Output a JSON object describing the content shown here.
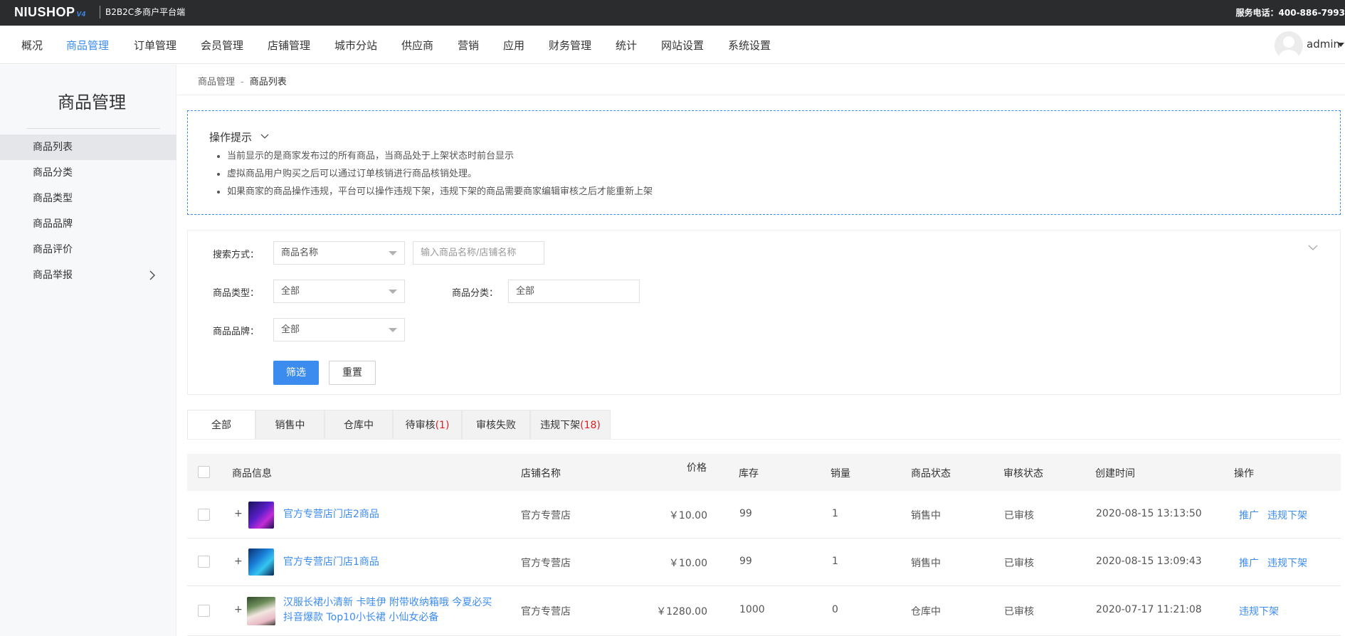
{
  "topbar": {
    "logo": "NIUSHOP",
    "logo_version": "V4",
    "subtitle": "B2B2C多商户平台端",
    "hotline": "服务电话：400-886-7993"
  },
  "nav": {
    "items": [
      "概况",
      "商品管理",
      "订单管理",
      "会员管理",
      "店铺管理",
      "城市分站",
      "供应商",
      "营销",
      "应用",
      "财务管理",
      "统计",
      "网站设置",
      "系统设置"
    ],
    "active": "商品管理",
    "user": "admin"
  },
  "sidebar": {
    "title": "商品管理",
    "items": [
      "商品列表",
      "商品分类",
      "商品类型",
      "商品品牌",
      "商品评价",
      "商品举报"
    ],
    "active": "商品列表"
  },
  "breadcrumb": [
    "商品管理",
    "商品列表"
  ],
  "tips": {
    "title": "操作提示",
    "items": [
      "当前显示的是商家发布过的所有商品，当商品处于上架状态时前台显示",
      "虚拟商品用户购买之后可以通过订单核销进行商品核销处理。",
      "如果商家的商品操作违规，平台可以操作违规下架，违规下架的商品需要商家编辑审核之后才能重新上架"
    ]
  },
  "filter": {
    "search_label": "搜索方式：",
    "search_mode": "商品名称",
    "search_placeholder": "输入商品名称/店铺名称",
    "type_label": "商品类型：",
    "type_value": "全部",
    "category_label": "商品分类：",
    "category_value": "全部",
    "brand_label": "商品品牌：",
    "brand_value": "全部",
    "submit": "筛选",
    "reset": "重置"
  },
  "tabs": [
    {
      "label": "全部",
      "count": ""
    },
    {
      "label": "销售中",
      "count": ""
    },
    {
      "label": "仓库中",
      "count": ""
    },
    {
      "label": "待审核",
      "count": "(1)"
    },
    {
      "label": "审核失败",
      "count": ""
    },
    {
      "label": "违规下架",
      "count": "(18)"
    }
  ],
  "table": {
    "headers": {
      "info": "商品信息",
      "store": "店铺名称",
      "price": "价格",
      "stock": "库存",
      "sales": "销量",
      "goods_status": "商品状态",
      "audit_status": "审核状态",
      "created": "创建时间",
      "actions": "操作"
    },
    "rows": [
      {
        "name": "官方专营店门店2商品",
        "store": "官方专营店",
        "price": "￥10.00",
        "stock": "99",
        "sales": "1",
        "goods_status": "销售中",
        "audit_status": "已审核",
        "created": "2020-08-15 13:13:50",
        "actions": [
          "推广",
          "违规下架"
        ]
      },
      {
        "name": "官方专营店门店1商品",
        "store": "官方专营店",
        "price": "￥10.00",
        "stock": "99",
        "sales": "1",
        "goods_status": "销售中",
        "audit_status": "已审核",
        "created": "2020-08-15 13:09:43",
        "actions": [
          "推广",
          "违规下架"
        ]
      },
      {
        "name": "汉服长裙小清新 卡哇伊 附带收纳箱哦 今夏必买 抖音爆款 Top10小长裙 小仙女必备",
        "name_line1": "汉服长裙小清新 卡哇伊 附带收纳箱哦 今夏必买",
        "name_line2": "抖音爆款 Top10小长裙 小仙女必备",
        "store": "官方专营店",
        "price": "￥1280.00",
        "stock": "1000",
        "sales": "0",
        "goods_status": "仓库中",
        "audit_status": "已审核",
        "created": "2020-07-17 11:21:08",
        "actions": [
          "违规下架"
        ]
      }
    ]
  },
  "colors": {
    "accent": "#3c8cf0",
    "topbar": "#2b2c2e",
    "count_red": "#e02020"
  }
}
